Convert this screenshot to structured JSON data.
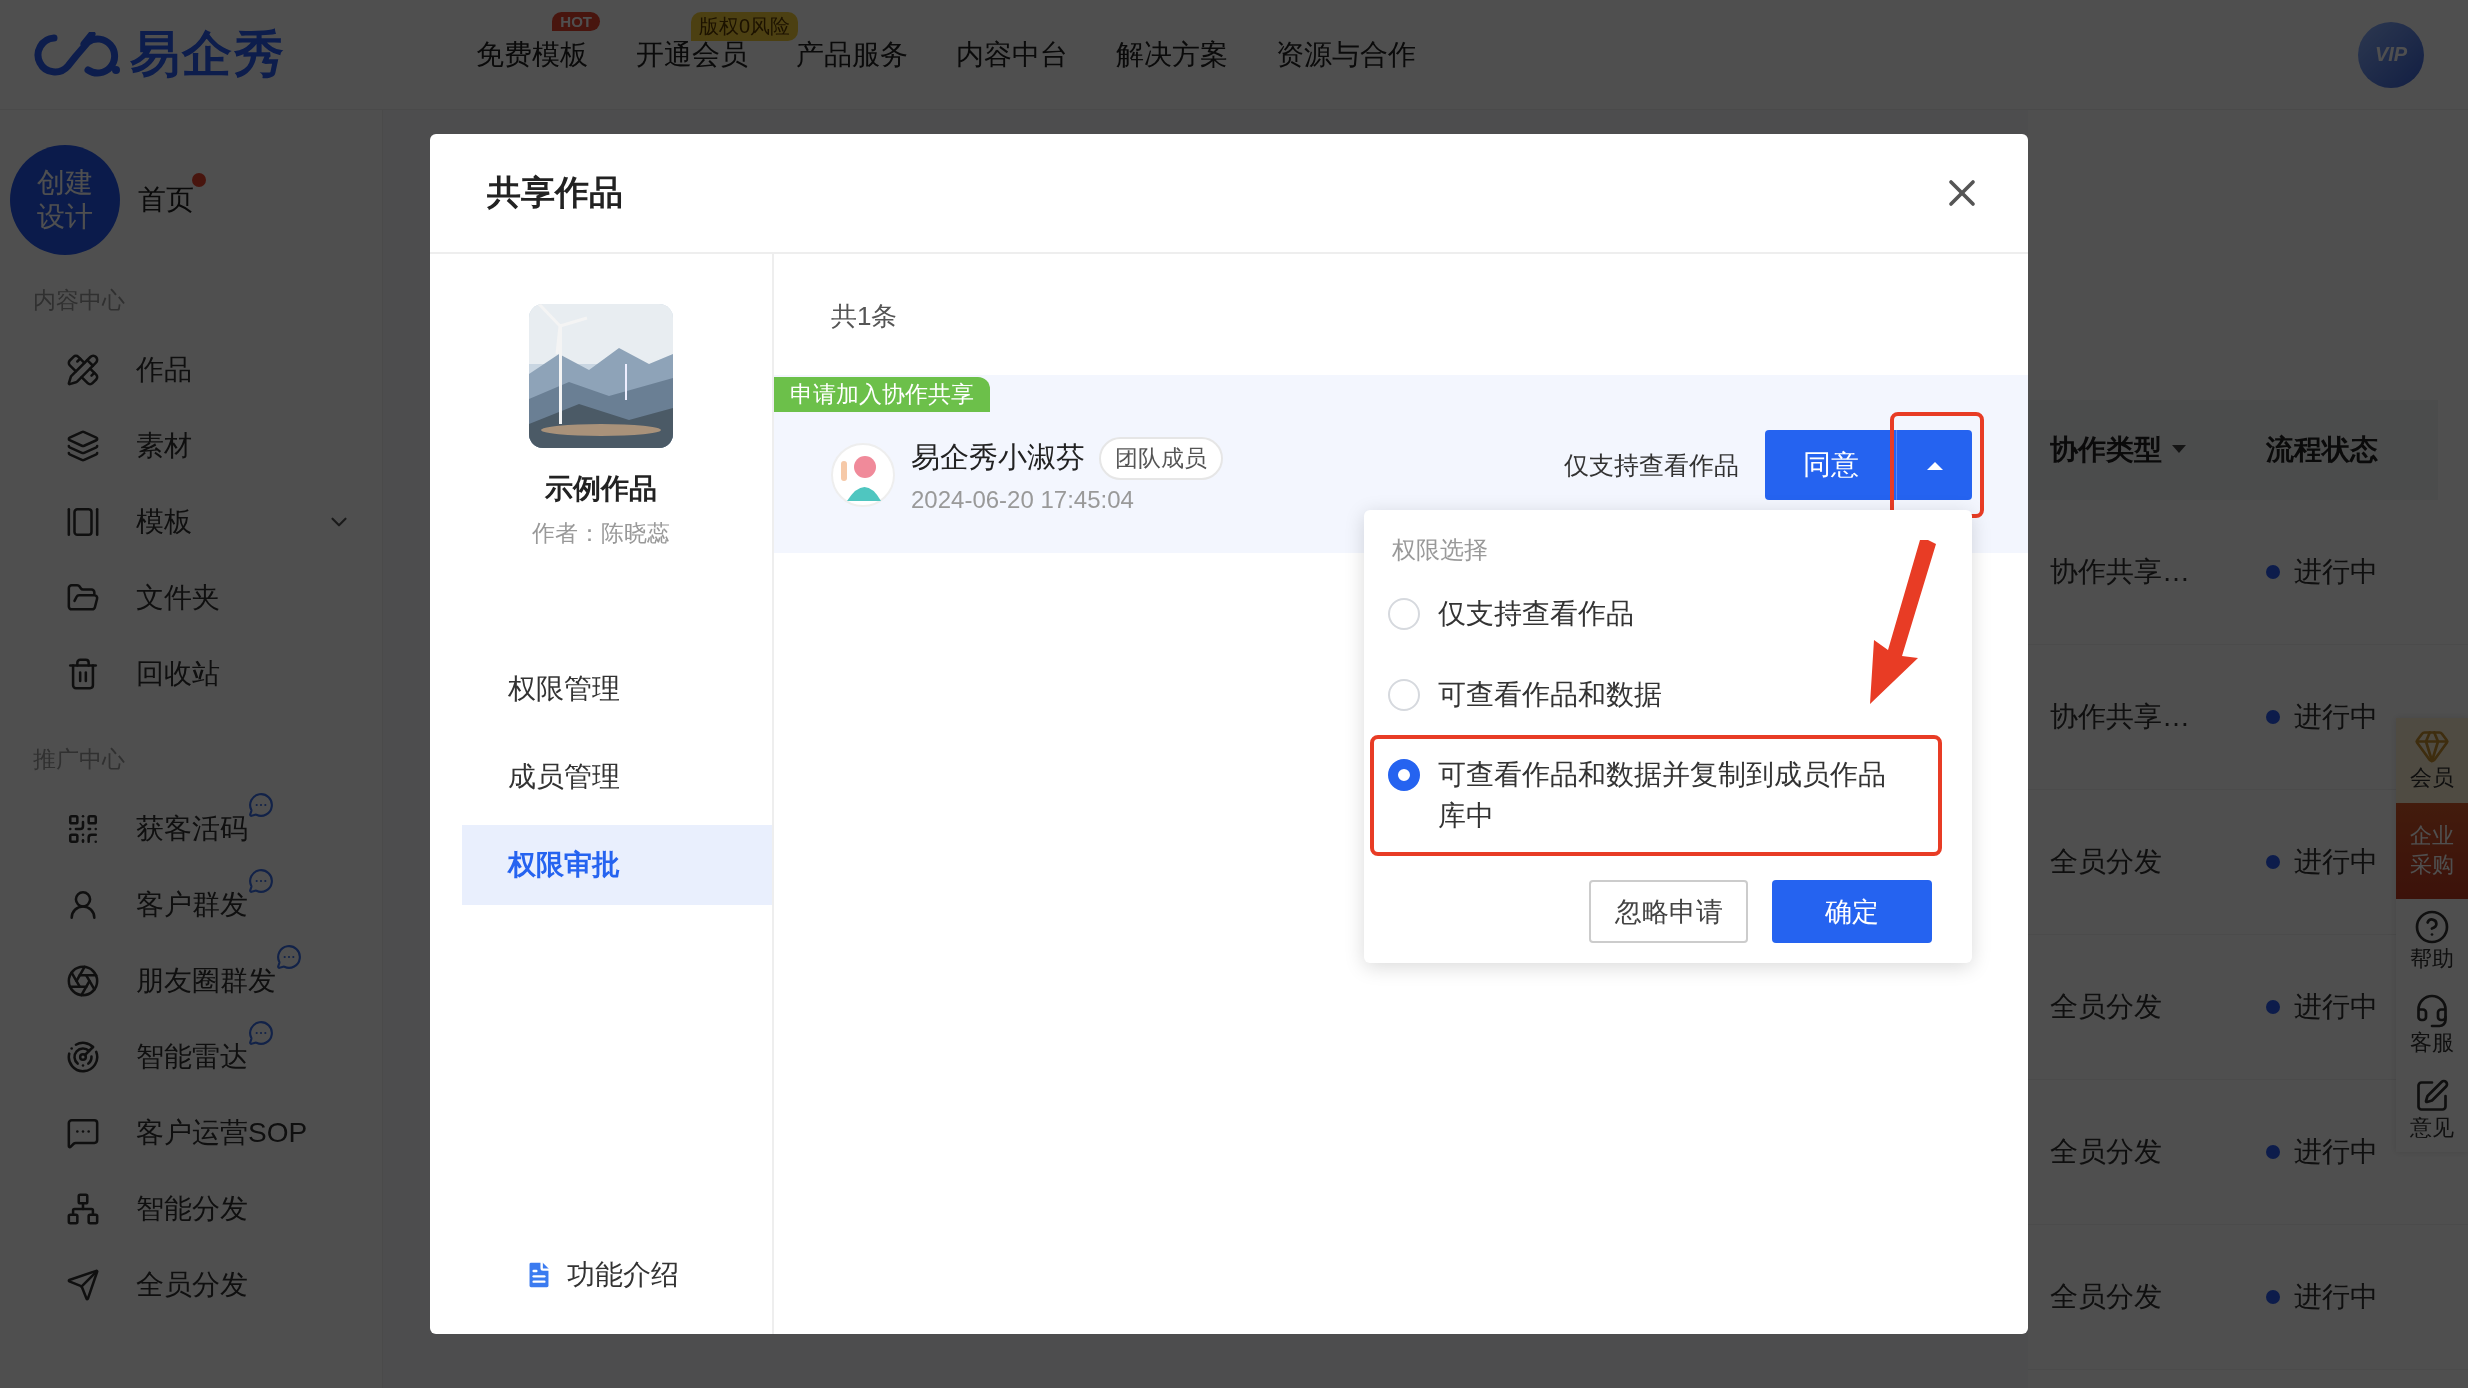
{
  "top_nav": {
    "logo": "易企秀",
    "items": [
      {
        "label": "免费模板",
        "badge": "HOT"
      },
      {
        "label": "开通会员",
        "badge": "版权0风险"
      },
      {
        "label": "产品服务"
      },
      {
        "label": "内容中台"
      },
      {
        "label": "解决方案"
      },
      {
        "label": "资源与合作"
      }
    ],
    "vip_badge": "VIP"
  },
  "sidebar": {
    "create_button": [
      "创建",
      "设计"
    ],
    "home": {
      "label": "首页",
      "dot": true
    },
    "sections": [
      {
        "title": "内容中心",
        "items": [
          {
            "label": "作品"
          },
          {
            "label": "素材"
          },
          {
            "label": "模板",
            "expandable": true
          },
          {
            "label": "文件夹"
          },
          {
            "label": "回收站"
          }
        ]
      },
      {
        "title": "推广中心",
        "items": [
          {
            "label": "获客活码",
            "chat_tag": true
          },
          {
            "label": "客户群发",
            "chat_tag": true
          },
          {
            "label": "朋友圈群发",
            "chat_tag": true
          },
          {
            "label": "智能雷达",
            "chat_tag": true
          },
          {
            "label": "客户运营SOP"
          },
          {
            "label": "智能分发"
          },
          {
            "label": "全员分发"
          }
        ]
      }
    ]
  },
  "table": {
    "columns": [
      {
        "label": "协作类型",
        "sortable": true
      },
      {
        "label": "流程状态"
      }
    ],
    "rows": [
      {
        "type": "协作共享…",
        "status": "进行中"
      },
      {
        "type": "协作共享…",
        "status": "进行中"
      },
      {
        "type": "全员分发",
        "status": "进行中"
      },
      {
        "type": "全员分发",
        "status": "进行中"
      },
      {
        "type": "全员分发",
        "status": "进行中"
      },
      {
        "type": "全员分发",
        "status": "进行中"
      }
    ]
  },
  "float_toolbar": [
    {
      "kind": "vip",
      "lines": [
        "会员"
      ]
    },
    {
      "kind": "purchase",
      "lines": [
        "企业",
        "采购"
      ]
    },
    {
      "kind": "help",
      "lines": [
        "帮助"
      ]
    },
    {
      "kind": "service",
      "lines": [
        "客服"
      ]
    },
    {
      "kind": "feedback",
      "lines": [
        "意见"
      ]
    }
  ],
  "modal": {
    "title": "共享作品",
    "work": {
      "kind": "picture",
      "title": "示例作品",
      "author": "作者：陈晓蕊"
    },
    "nav": [
      {
        "label": "权限管理",
        "selected": false
      },
      {
        "label": "成员管理",
        "selected": false
      },
      {
        "label": "权限审批",
        "selected": true
      }
    ],
    "footer_link": "功能介绍",
    "count": "共1条",
    "request": {
      "tag": "申请加入协作共享",
      "name": "易企秀小淑芬",
      "role": "团队成员",
      "time": "2024-06-20 17:45:04",
      "permission": "仅支持查看作品",
      "agree_button": "同意",
      "caret_highlighted": true,
      "menu_open": true
    },
    "popover": {
      "title": "权限选择",
      "options": [
        {
          "label": "仅支持查看作品",
          "selected": false,
          "highlighted": false
        },
        {
          "label": "可查看作品和数据",
          "selected": false,
          "highlighted": false
        },
        {
          "label": "可查看作品和数据并复制到成员作品库中",
          "selected": true,
          "highlighted": true
        }
      ],
      "ignore_button": "忽略申请",
      "confirm_button": "确定"
    }
  }
}
